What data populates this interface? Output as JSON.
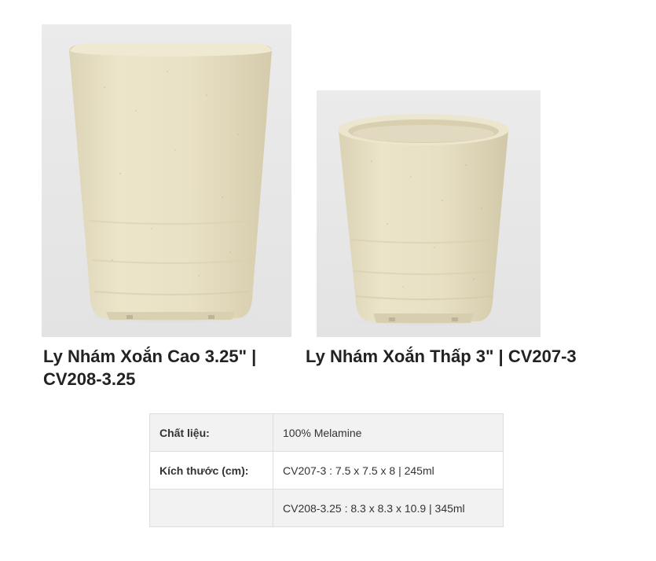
{
  "products": [
    {
      "title": "Ly Nhám Xoắn Cao 3.25\" | CV208-3.25",
      "image": "tall-beige-speckled-melamine-cup"
    },
    {
      "title": "Ly Nhám Xoắn Thấp 3\" | CV207-3",
      "image": "short-beige-speckled-melamine-cup"
    }
  ],
  "spec_table": {
    "rows": [
      {
        "label": "Chất liệu:",
        "value": "100% Melamine"
      },
      {
        "label": "Kích thước (cm):",
        "value": "CV207-3 : 7.5 x 7.5 x 8 | 245ml"
      },
      {
        "label": "",
        "value": "CV208-3.25 : 8.3 x 8.3 x 10.9 | 345ml"
      }
    ]
  },
  "colors": {
    "photo_background": "#e9e9e9",
    "cup_body": "#e9e1c6",
    "cup_shadow": "#d6cdaf",
    "table_border": "#dddddd",
    "table_stripe": "#f2f2f2",
    "title_text": "#222222"
  }
}
